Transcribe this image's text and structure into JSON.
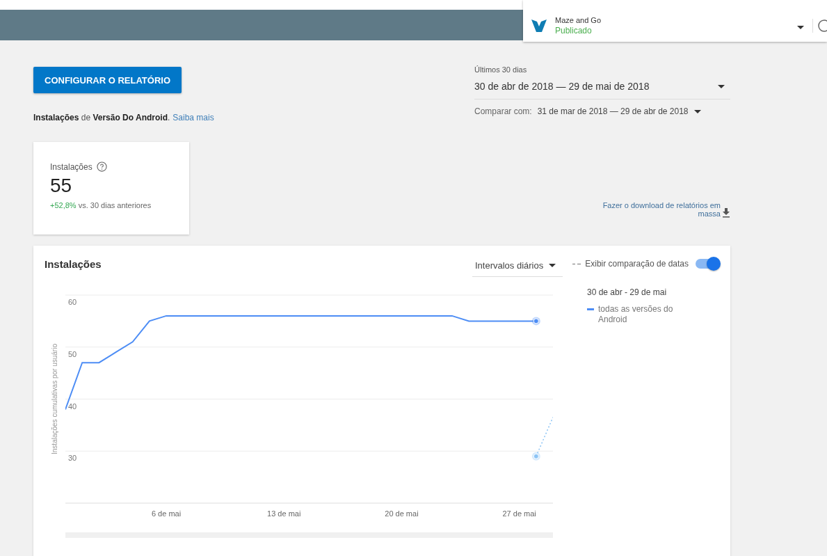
{
  "app_selector": {
    "name": "Maze and Go",
    "status": "Publicado"
  },
  "configure_button": "CONFIGURAR O RELATÓRIO",
  "description": {
    "text": "**Instalações** de **Versão Do Android**.",
    "link": "Saiba mais"
  },
  "date_range": {
    "label": "Últimos 30 dias",
    "value": "30 de abr de 2018 — 29 de mai de 2018",
    "compare_label": "Comparar com:",
    "compare_value": "31 de mar de 2018 — 29 de abr de 2018"
  },
  "summary": {
    "title": "Instalações",
    "value": "55",
    "change": "+52,8%",
    "change_text": "vs. 30 dias anteriores"
  },
  "download_link": "Fazer o download de relatórios em massa",
  "chart_card": {
    "title": "Instalações",
    "interval": "Intervalos diários",
    "compare_label": "Exibir comparação de datas",
    "compare_on": true,
    "legend_title": "30 de abr - 29 de mai",
    "chart_data": {
      "type": "line",
      "ylabel": "Instalações cumulativas por usuário",
      "grid": true,
      "x": [
        0,
        1,
        2,
        3,
        4,
        5,
        6,
        7,
        8,
        9,
        10,
        11,
        12,
        13,
        14,
        15,
        16,
        17,
        18,
        19,
        20,
        21,
        22,
        23,
        24,
        25,
        26,
        27,
        28,
        29
      ],
      "xlim": [
        0,
        29
      ],
      "ylim": [
        20,
        60
      ],
      "xticks": [
        {
          "value": 6,
          "label": "6 de mai"
        },
        {
          "value": 13,
          "label": "13 de mai"
        },
        {
          "value": 20,
          "label": "20 de mai"
        },
        {
          "value": 27,
          "label": "27 de mai"
        }
      ],
      "yticks": [
        30,
        40,
        50,
        60
      ],
      "series": [
        {
          "name": "todas as versões do Android",
          "color": "#4d8df5",
          "line_style": "solid",
          "values": [
            38,
            47,
            47,
            49,
            51,
            55,
            56,
            56,
            56,
            56,
            56,
            56,
            56,
            56,
            56,
            56,
            56,
            56,
            56,
            56,
            56,
            56,
            56,
            56,
            55,
            55,
            55,
            55,
            55,
            null
          ]
        },
        {
          "color": "#8cc4f5",
          "line_style": "dotted",
          "values": [
            null,
            null,
            null,
            null,
            null,
            null,
            null,
            null,
            null,
            null,
            null,
            null,
            null,
            null,
            null,
            null,
            null,
            null,
            null,
            null,
            null,
            null,
            null,
            null,
            null,
            null,
            null,
            null,
            29,
            36.5
          ]
        }
      ]
    }
  }
}
